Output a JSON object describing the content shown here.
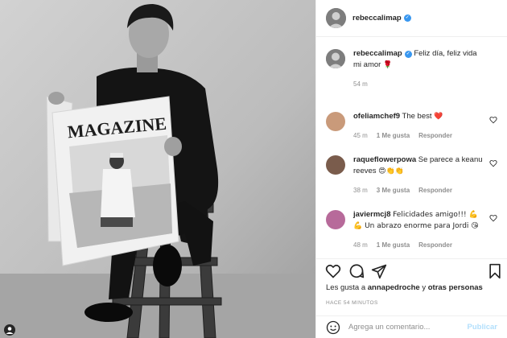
{
  "post": {
    "author": "rebeccalimap",
    "photo_magazine_title": "MAGAZINE",
    "caption": {
      "user": "rebeccalimap",
      "text": "Feliz día, feliz vida mi amor",
      "emoji": "🌹",
      "time": "54 m"
    },
    "comments": [
      {
        "user": "ofeliamchef9",
        "text": "The best",
        "emoji": "❤️",
        "time": "45 m",
        "likes": "1 Me gusta",
        "reply": "Responder",
        "avatar_color": "#c99a7a"
      },
      {
        "user": "raqueflowerpowa",
        "text": "Se parece a keanu reeves",
        "emoji": "😍👏👏",
        "time": "38 m",
        "likes": "3 Me gusta",
        "reply": "Responder",
        "avatar_color": "#7a5c4c"
      },
      {
        "user": "javiermcj8",
        "text": "Felicidades amigo!!! 💪 💪 Un abrazo enorme para Jordi 😘",
        "emoji": "",
        "time": "48 m",
        "likes": "1 Me gusta",
        "reply": "Responder",
        "avatar_color": "#b76a9a"
      }
    ],
    "likes_prefix": "Les gusta a",
    "likes_user": "annapedroche",
    "likes_and": "y",
    "likes_others": "otras personas",
    "posted_ago": "HACE 54 MINUTOS",
    "comment_placeholder": "Agrega un comentario...",
    "post_button": "Publicar",
    "icons": [
      "heart-icon",
      "comment-icon",
      "share-icon",
      "bookmark-icon",
      "emoji-icon",
      "verified-icon",
      "profile-icon"
    ],
    "colors": {
      "link_blue": "#3897f0",
      "post_disabled": "#b2dffc",
      "muted": "#8e8e8e",
      "red": "#ed4956"
    }
  }
}
